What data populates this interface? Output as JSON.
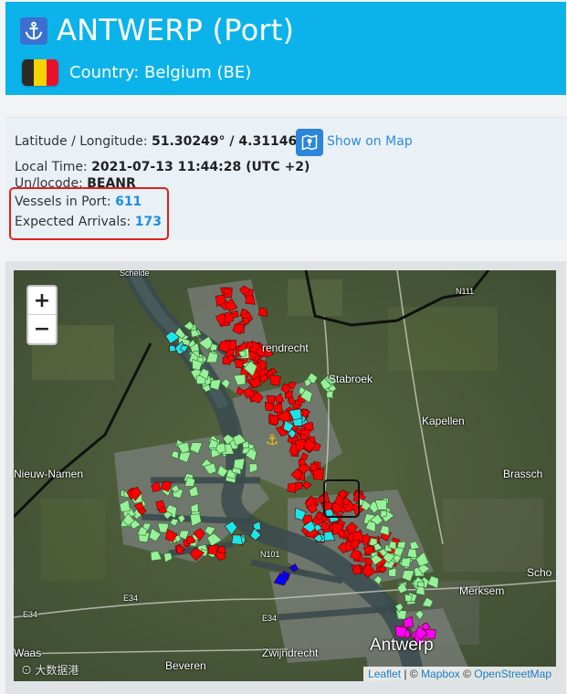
{
  "header": {
    "title": "ANTWERP (Port)",
    "country": "Country: Belgium (BE)",
    "flag_colors": [
      "#2d2926",
      "#f5d300",
      "#e8112d"
    ],
    "anchor_icon": "anchor-icon"
  },
  "info": {
    "latlon_label": "Latitude / Longitude:",
    "latlon_value": "51.30249° / 4.3114605°",
    "show_on_map": "Show on Map",
    "local_time_label": "Local Time:",
    "local_time_value": "2021-07-13 11:44:28 (UTC +2)",
    "unlocode_label": "Un/locode:",
    "unlocode_value": "BEANR",
    "vessels_label": "Vessels in Port:",
    "vessels_value": "611",
    "arrivals_label": "Expected Arrivals:",
    "arrivals_value": "173"
  },
  "map": {
    "zoom_in": "+",
    "zoom_out": "−",
    "places": {
      "scheldt": "Schelde",
      "n111": "N111",
      "berendrecht": "rendrecht",
      "stabroek": "Stabroek",
      "kapellen": "Kapellen",
      "nieuw_namen": "Nieuw-Namen",
      "brasschaat": "Brassch",
      "schoten": "Scho",
      "n101": "N101",
      "e34_a": "E34",
      "e34_b": "E34",
      "merksem": "Merksem",
      "waas": "Waas",
      "beveren": "Beveren",
      "zwijndrecht": "Zwijndrecht",
      "antwerp": "Antwerp"
    },
    "attribution": {
      "leaflet": "Leaflet",
      "sep": " | © ",
      "mapbox": "Mapbox",
      "sep2": " © ",
      "osm": "OpenStreetMap"
    },
    "vessel_colors": {
      "cargo": "#98f09a",
      "tanker": "#ff0000",
      "passenger": "#0000ff",
      "special": "#19e6e6",
      "other": "#ff00ff"
    }
  },
  "watermark": "⊙ 大数据港"
}
